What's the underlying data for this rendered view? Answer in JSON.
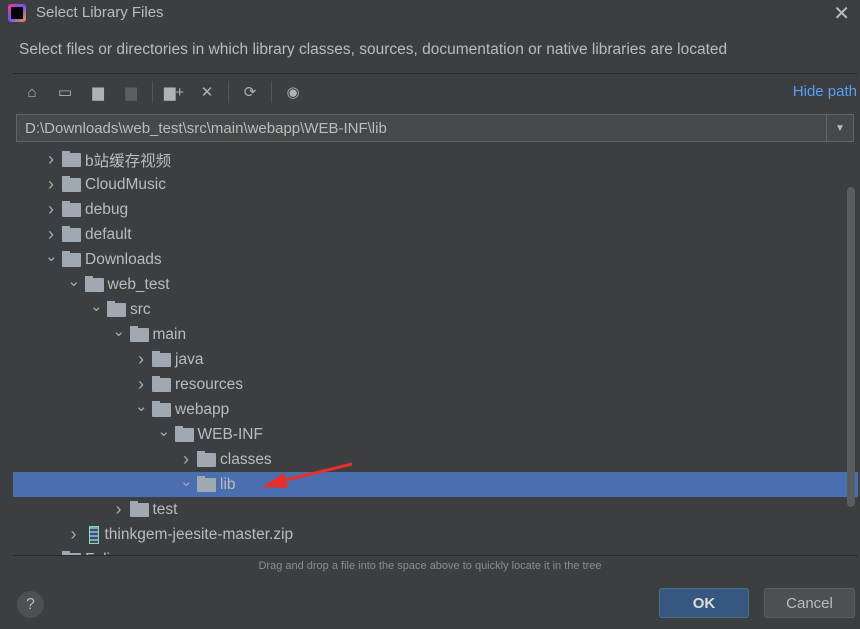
{
  "window": {
    "title": "Select Library Files",
    "close_icon": "close-icon"
  },
  "description": "Select files or directories in which library classes, sources, documentation or native libraries are located",
  "toolbar": {
    "icons": [
      "home-icon",
      "desktop-icon",
      "project-icon",
      "module-icon",
      "new-folder-icon",
      "delete-icon",
      "refresh-icon",
      "show-hidden-icon"
    ],
    "hide_path": "Hide path"
  },
  "path": {
    "value": "D:\\Downloads\\web_test\\src\\main\\webapp\\WEB-INF\\lib"
  },
  "tree": [
    {
      "label": "b站缓存视频",
      "level": 0,
      "expanded": false,
      "type": "folder"
    },
    {
      "label": "CloudMusic",
      "level": 0,
      "expanded": false,
      "type": "folder"
    },
    {
      "label": "debug",
      "level": 0,
      "expanded": false,
      "type": "folder"
    },
    {
      "label": "default",
      "level": 0,
      "expanded": false,
      "type": "folder"
    },
    {
      "label": "Downloads",
      "level": 0,
      "expanded": true,
      "type": "folder"
    },
    {
      "label": "web_test",
      "level": 1,
      "expanded": true,
      "type": "folder"
    },
    {
      "label": "src",
      "level": 2,
      "expanded": true,
      "type": "folder"
    },
    {
      "label": "main",
      "level": 3,
      "expanded": true,
      "type": "folder"
    },
    {
      "label": "java",
      "level": 4,
      "expanded": false,
      "type": "folder"
    },
    {
      "label": "resources",
      "level": 4,
      "expanded": false,
      "type": "folder"
    },
    {
      "label": "webapp",
      "level": 4,
      "expanded": true,
      "type": "folder"
    },
    {
      "label": "WEB-INF",
      "level": 5,
      "expanded": true,
      "type": "folder"
    },
    {
      "label": "classes",
      "level": 6,
      "expanded": false,
      "type": "folder"
    },
    {
      "label": "lib",
      "level": 6,
      "expanded": true,
      "type": "folder",
      "selected": true
    },
    {
      "label": "test",
      "level": 3,
      "expanded": false,
      "type": "folder"
    },
    {
      "label": "thinkgem-jeesite-master.zip",
      "level": 1,
      "expanded": false,
      "type": "zip"
    },
    {
      "label": "Folia",
      "level": 0,
      "expanded": false,
      "type": "folder"
    }
  ],
  "hint": "Drag and drop a file into the space above to quickly locate it in the tree",
  "buttons": {
    "help": "?",
    "ok": "OK",
    "cancel": "Cancel"
  },
  "colors": {
    "selection": "#4b6eaf",
    "link": "#589df6",
    "annotation_arrow": "#e8302a"
  }
}
